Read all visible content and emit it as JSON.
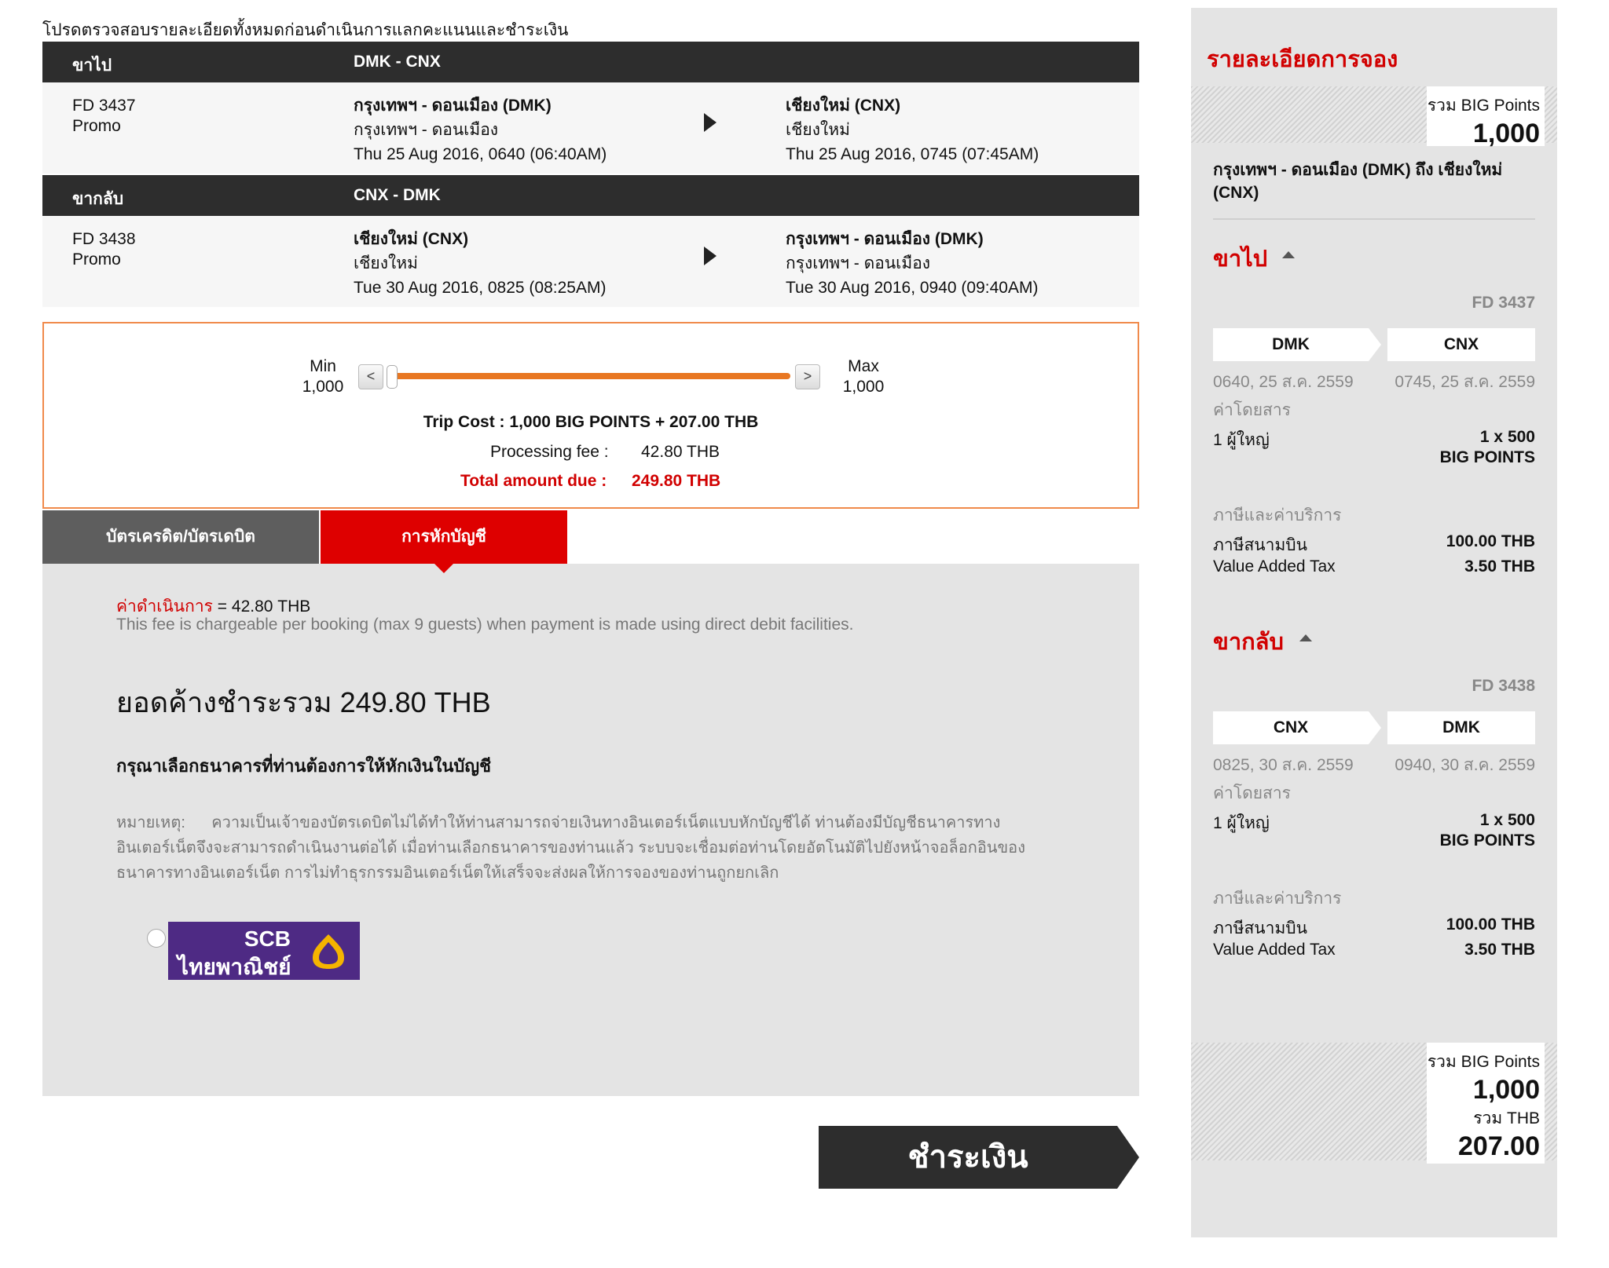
{
  "notice": "โปรดตรวจสอบรายละเอียดทั้งหมดก่อนดำเนินการแลกคะแนนและชำระเงิน",
  "depart": {
    "label": "ขาไป",
    "route": "DMK - CNX",
    "flight_no": "FD 3437",
    "fare_type": "Promo",
    "from_airport": "กรุงเทพฯ - ดอนเมือง (DMK)",
    "from_city": "กรุงเทพฯ - ดอนเมือง",
    "from_time": "Thu 25 Aug 2016, 0640 (06:40AM)",
    "to_airport": "เชียงใหม่ (CNX)",
    "to_city": "เชียงใหม่",
    "to_time": "Thu 25 Aug 2016, 0745 (07:45AM)"
  },
  "return": {
    "label": "ขากลับ",
    "route": "CNX - DMK",
    "flight_no": "FD 3438",
    "fare_type": "Promo",
    "from_airport": "เชียงใหม่ (CNX)",
    "from_city": "เชียงใหม่",
    "from_time": "Tue 30 Aug 2016, 0825 (08:25AM)",
    "to_airport": "กรุงเทพฯ - ดอนเมือง (DMK)",
    "to_city": "กรุงเทพฯ - ดอนเมือง",
    "to_time": "Tue 30 Aug 2016, 0940 (09:40AM)"
  },
  "points_slider": {
    "min_label": "Min",
    "min_value": "1,000",
    "max_label": "Max",
    "max_value": "1,000",
    "prev": "<",
    "next": ">",
    "trip_cost": "Trip Cost : 1,000 BIG POINTS + 207.00 THB",
    "processing_label": "Processing fee :",
    "processing_value": "42.80 THB",
    "total_label": "Total amount due :",
    "total_value": "249.80 THB"
  },
  "tabs": {
    "card": "บัตรเครดิต/บัตรเดบิต",
    "debit": "การหักบัญชี"
  },
  "debit": {
    "fee_label": "ค่าดำเนินการ",
    "fee_value": "= 42.80 THB",
    "fee_note": "This fee is chargeable per booking (max 9 guests) when payment is made using direct debit facilities.",
    "total_due": "ยอดค้างชำระรวม 249.80 THB",
    "choose_bank": "กรุณาเลือกธนาคารที่ท่านต้องการให้หักเงินในบัญชี",
    "note_label": "หมายเหตุ:",
    "note_line1": "ความเป็นเจ้าของบัตรเดบิตไม่ได้ทำให้ท่านสามารถจ่ายเงินทางอินเตอร์เน็ตแบบหักบัญชีได้     ท่านต้องมีบัญชีธนาคารทาง",
    "note_line2": "อินเตอร์เน็ตจึงจะสามารถดำเนินงานต่อได้    เมื่อท่านเลือกธนาคารของท่านแล้ว    ระบบจะเชื่อมต่อท่านโดยอัตโนมัติไปยังหน้าจอล็อกอินของ",
    "note_line3": "ธนาคารทางอินเตอร์เน็ต การไม่ทำธุรกรรมอินเตอร์เน็ตให้เสร็จจะส่งผลให้การจองของท่านถูกยกเลิก",
    "bank_en": "SCB",
    "bank_th": "ไทยพาณิชย์"
  },
  "pay_button": "ชำระเงิน",
  "sidebar": {
    "title": "รายละเอียดการจอง",
    "total_points_label": "รวม BIG Points",
    "total_points": "1,000",
    "route_title": "กรุงเทพฯ - ดอนเมือง (DMK) ถึง เชียงใหม่ (CNX)",
    "depart": {
      "label": "ขาไป",
      "flight_no": "FD 3437",
      "from": "DMK",
      "to": "CNX",
      "from_time": "0640, 25 ส.ค. 2559",
      "to_time": "0745, 25 ส.ค. 2559",
      "fare_label": "ค่าโดยสาร",
      "pax": "1 ผู้ใหญ่",
      "fare_qty": "1 x 500",
      "fare_unit": "BIG POINTS",
      "tax_label": "ภาษีและค่าบริการ",
      "airport_tax_label": "ภาษีสนามบิน",
      "airport_tax": "100.00 THB",
      "vat_label": "Value Added Tax",
      "vat": "3.50 THB"
    },
    "return": {
      "label": "ขากลับ",
      "flight_no": "FD 3438",
      "from": "CNX",
      "to": "DMK",
      "from_time": "0825, 30 ส.ค. 2559",
      "to_time": "0940, 30 ส.ค. 2559",
      "fare_label": "ค่าโดยสาร",
      "pax": "1 ผู้ใหญ่",
      "fare_qty": "1 x 500",
      "fare_unit": "BIG POINTS",
      "tax_label": "ภาษีและค่าบริการ",
      "airport_tax_label": "ภาษีสนามบิน",
      "airport_tax": "100.00 THB",
      "vat_label": "Value Added Tax",
      "vat": "3.50 THB"
    },
    "bottom_points_label": "รวม BIG Points",
    "bottom_points": "1,000",
    "bottom_thb_label": "รวม THB",
    "bottom_thb": "207.00"
  }
}
